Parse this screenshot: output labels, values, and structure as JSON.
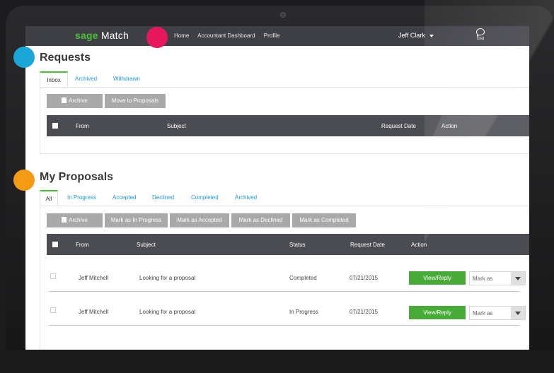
{
  "topbar": {
    "brand_sage": "sage",
    "brand_match": "Match",
    "nav": [
      "Home",
      "Accountant Dashboard",
      "Profile"
    ],
    "user": "Jeff Clark",
    "chat": "Chat"
  },
  "requests": {
    "title": "Requests",
    "tabs": [
      "Inbox",
      "Archived",
      "Withdrawn"
    ],
    "buttons": [
      "Archive",
      "Move to Proposals"
    ],
    "columns": [
      "From",
      "Subject",
      "Request Date",
      "Action"
    ]
  },
  "proposals": {
    "title": "My Proposals",
    "tabs": [
      "All",
      "In Progress",
      "Accepted",
      "Declined",
      "Completed",
      "Archived"
    ],
    "buttons": [
      "Archive",
      "Mark as In Progress",
      "Mark as Accepted",
      "Mark as Declined",
      "Mark as Completed"
    ],
    "columns": [
      "From",
      "Subject",
      "Status",
      "Request Date",
      "Action"
    ],
    "rows": [
      {
        "from": "Jeff Mitchell",
        "subject": "Looking for a proposal",
        "status": "Completed",
        "date": "07/21/2015",
        "action": "View/Reply",
        "mark": "Mark as"
      },
      {
        "from": "Jeff Mitchell",
        "subject": "Looking for a proposal",
        "status": "In Progress",
        "date": "07/21/2015",
        "action": "View/Reply",
        "mark": "Mark as"
      }
    ]
  },
  "colors": {
    "accent_green": "#48c232",
    "button_green": "#48ab38",
    "topbar": "#3f4046",
    "link_blue": "#1a9ad6",
    "marker_pink": "#e8175d",
    "marker_blue": "#1aa6d6",
    "marker_orange": "#f59a13"
  },
  "icons": [
    "archive-icon",
    "chat-icon",
    "chevron-down-icon"
  ]
}
